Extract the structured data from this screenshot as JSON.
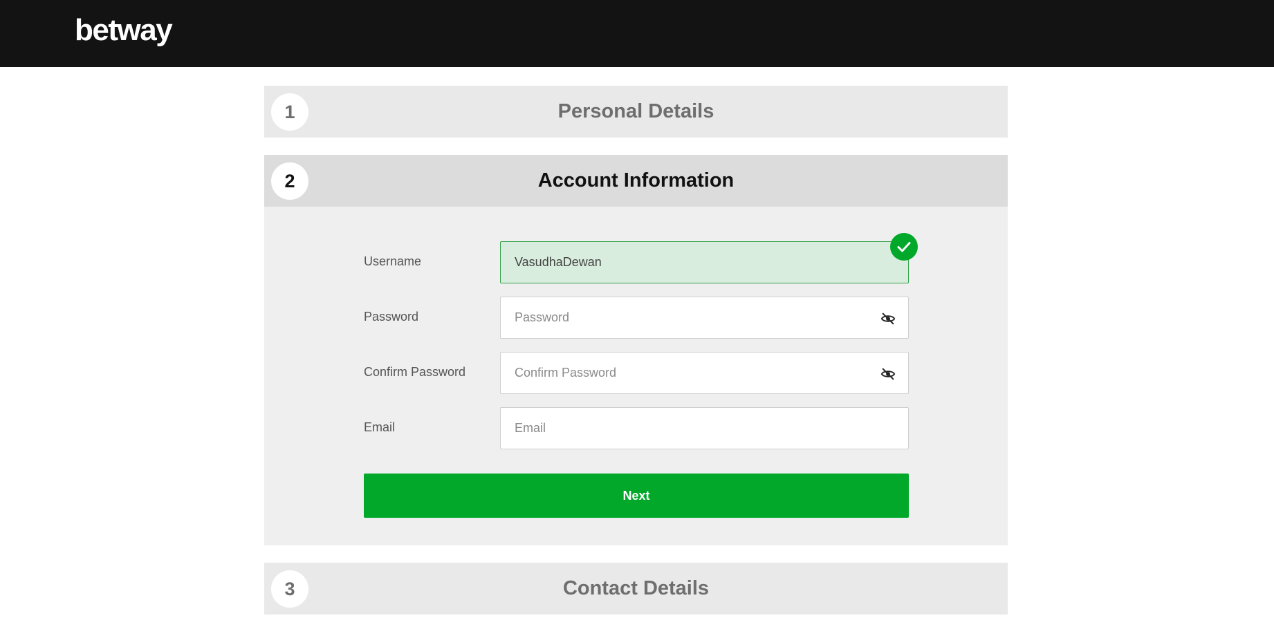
{
  "header": {
    "logo_text": "betway"
  },
  "steps": [
    {
      "number": "1",
      "title": "Personal Details",
      "state": "collapsed"
    },
    {
      "number": "2",
      "title": "Account Information",
      "state": "active"
    },
    {
      "number": "3",
      "title": "Contact Details",
      "state": "collapsed"
    }
  ],
  "form": {
    "username": {
      "label": "Username",
      "value": "VasudhaDewan",
      "status": "valid"
    },
    "password": {
      "label": "Password",
      "placeholder": "Password",
      "value": ""
    },
    "confirm_password": {
      "label": "Confirm Password",
      "placeholder": "Confirm Password",
      "value": ""
    },
    "email": {
      "label": "Email",
      "placeholder": "Email",
      "value": ""
    },
    "next_label": "Next"
  },
  "icons": {
    "valid_check": "check-icon",
    "show_password": "eye-slash-icon"
  },
  "colors": {
    "header_bg": "#131313",
    "accent_green": "#02a82a",
    "valid_field_bg": "#d8eddd"
  }
}
